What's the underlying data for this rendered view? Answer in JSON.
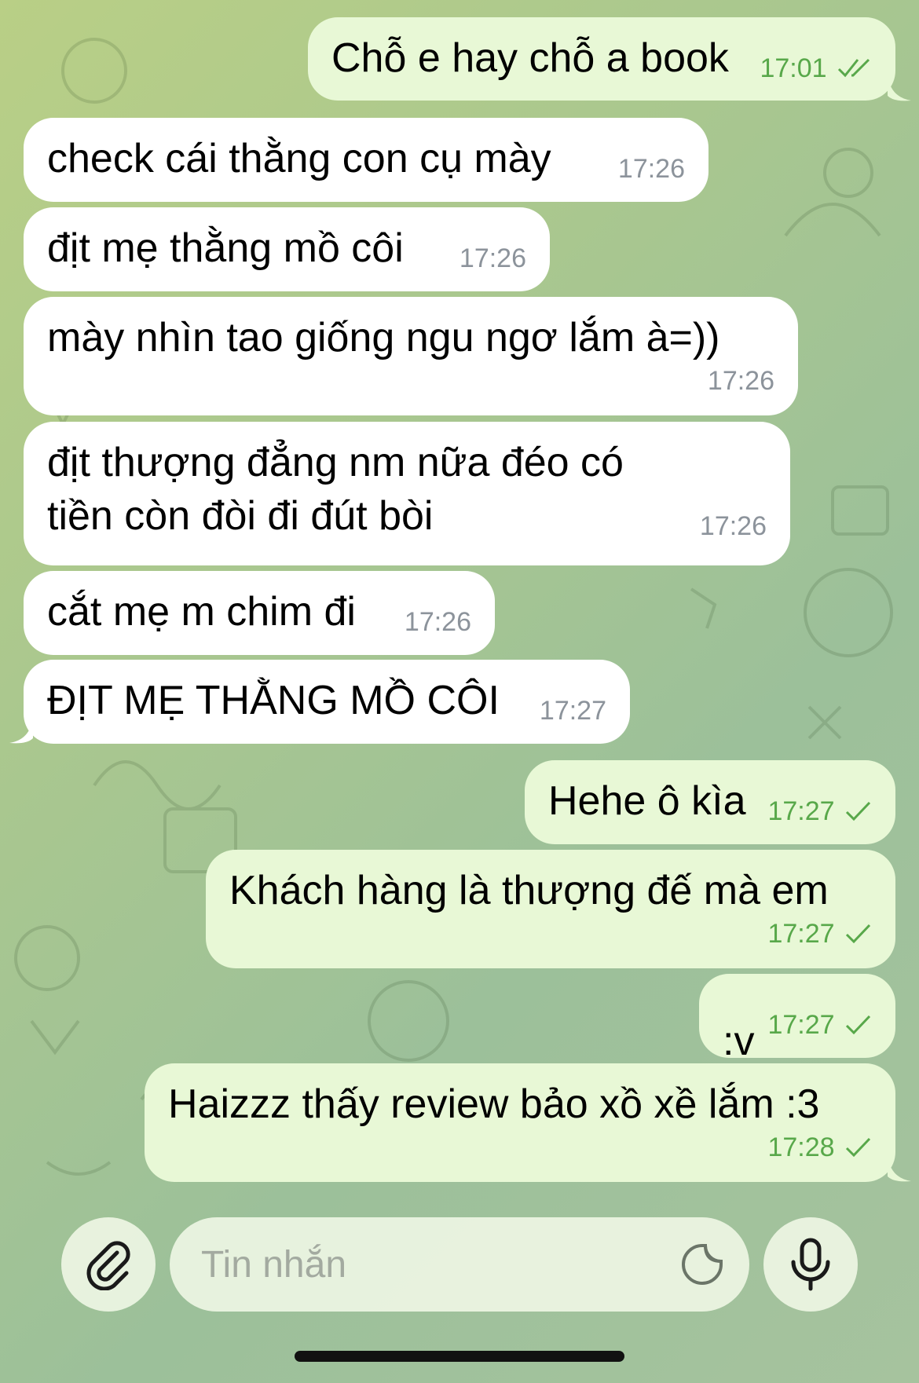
{
  "messages": [
    {
      "dir": "out",
      "text": "Chỗ e hay chỗ a book",
      "time": "17:01",
      "status": "read"
    },
    {
      "dir": "in",
      "text": "check cái thằng con cụ mày",
      "time": "17:26"
    },
    {
      "dir": "in",
      "text": "địt mẹ thằng mồ côi",
      "time": "17:26"
    },
    {
      "dir": "in",
      "text": "mày nhìn tao giống ngu ngơ lắm à=))",
      "time": "17:26"
    },
    {
      "dir": "in",
      "text": "địt thượng đẳng nm nữa đéo có tiền còn đòi đi đút bòi",
      "time": "17:26"
    },
    {
      "dir": "in",
      "text": "cắt mẹ m chim đi",
      "time": "17:26"
    },
    {
      "dir": "in",
      "text": "ĐỊT MẸ THẰNG MỒ CÔI",
      "time": "17:27"
    },
    {
      "dir": "out",
      "text": "Hehe ô kìa",
      "time": "17:27",
      "status": "sent"
    },
    {
      "dir": "out",
      "text": "Khách hàng là thượng đế mà em",
      "time": "17:27",
      "status": "sent"
    },
    {
      "dir": "out",
      "text": ":v",
      "time": "17:27",
      "status": "sent"
    },
    {
      "dir": "out",
      "text": "Haizzz thấy review bảo xồ xề lắm :3",
      "time": "17:28",
      "status": "sent"
    }
  ],
  "composer": {
    "placeholder": "Tin nhắn",
    "attach_icon": "paperclip-icon",
    "sticker_icon": "sticker-icon",
    "mic_icon": "microphone-icon"
  },
  "colors": {
    "incoming_bubble": "#ffffff",
    "outgoing_bubble": "#e8f8d6",
    "outgoing_meta": "#58a84a",
    "incoming_meta": "#8c939b"
  }
}
